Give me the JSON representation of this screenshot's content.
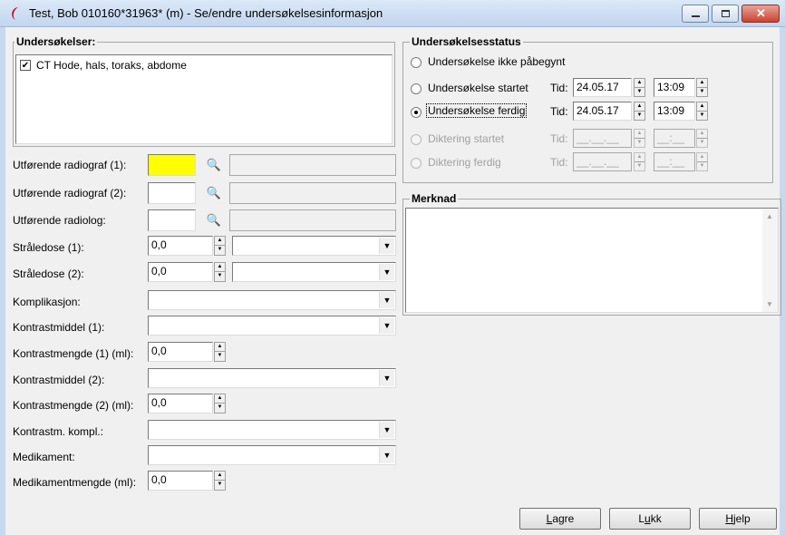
{
  "window": {
    "title": "Test, Bob  010160*31963* (m) - Se/endre undersøkelsesinformasjon",
    "icon": "app-icon",
    "controls": [
      "minimize",
      "maximize",
      "close"
    ]
  },
  "exams": {
    "title": "Undersøkelser:",
    "items": [
      {
        "label": "CT Hode, hals, toraks, abdome",
        "checked": true
      }
    ]
  },
  "fields": {
    "radiograf1": {
      "label": "Utførende radiograf (1):",
      "value": "",
      "highlight": "#ffff00"
    },
    "radiograf2": {
      "label": "Utførende radiograf (2):",
      "value": ""
    },
    "radiolog": {
      "label": "Utførende radiolog:",
      "value": ""
    },
    "straledose1": {
      "label": "Stråledose (1):",
      "value": "0,0"
    },
    "straledose2": {
      "label": "Stråledose (2):",
      "value": "0,0"
    },
    "komplikasjon": {
      "label": "Komplikasjon:"
    },
    "kontrastmiddel1": {
      "label": "Kontrastmiddel (1):"
    },
    "kontrastmengde1": {
      "label": "Kontrastmengde (1) (ml):",
      "value": "0,0"
    },
    "kontrastmiddel2": {
      "label": "Kontrastmiddel (2):"
    },
    "kontrastmengde2": {
      "label": "Kontrastmengde (2) (ml):",
      "value": "0,0"
    },
    "kontrastm_kompl": {
      "label": "Kontrastm. kompl.:"
    },
    "medikament": {
      "label": "Medikament:"
    },
    "medikamentmengde": {
      "label": "Medikamentmengde (ml):",
      "value": "0,0"
    }
  },
  "status": {
    "title": "Undersøkelsesstatus",
    "tid_label": "Tid:",
    "options": [
      {
        "label": "Undersøkelse ikke påbegynt",
        "selected": false,
        "enabled": true
      },
      {
        "label": "Undersøkelse startet",
        "selected": false,
        "enabled": true,
        "date": "24.05.17",
        "time": "13:09"
      },
      {
        "label": "Undersøkelse ferdig",
        "selected": true,
        "enabled": true,
        "date": "24.05.17",
        "time": "13:09"
      },
      {
        "label": "Diktering startet",
        "selected": false,
        "enabled": false,
        "date": "__.__.__",
        "time": "__:__"
      },
      {
        "label": "Diktering ferdig",
        "selected": false,
        "enabled": false,
        "date": "__.__.__",
        "time": "__:__"
      }
    ]
  },
  "merknad": {
    "title": "Merknad",
    "value": ""
  },
  "buttons": {
    "save": {
      "first": "L",
      "rest": "agre"
    },
    "close": {
      "pre": "L",
      "u": "u",
      "post": "kk"
    },
    "help": {
      "first": "H",
      "rest": "jelp"
    }
  }
}
